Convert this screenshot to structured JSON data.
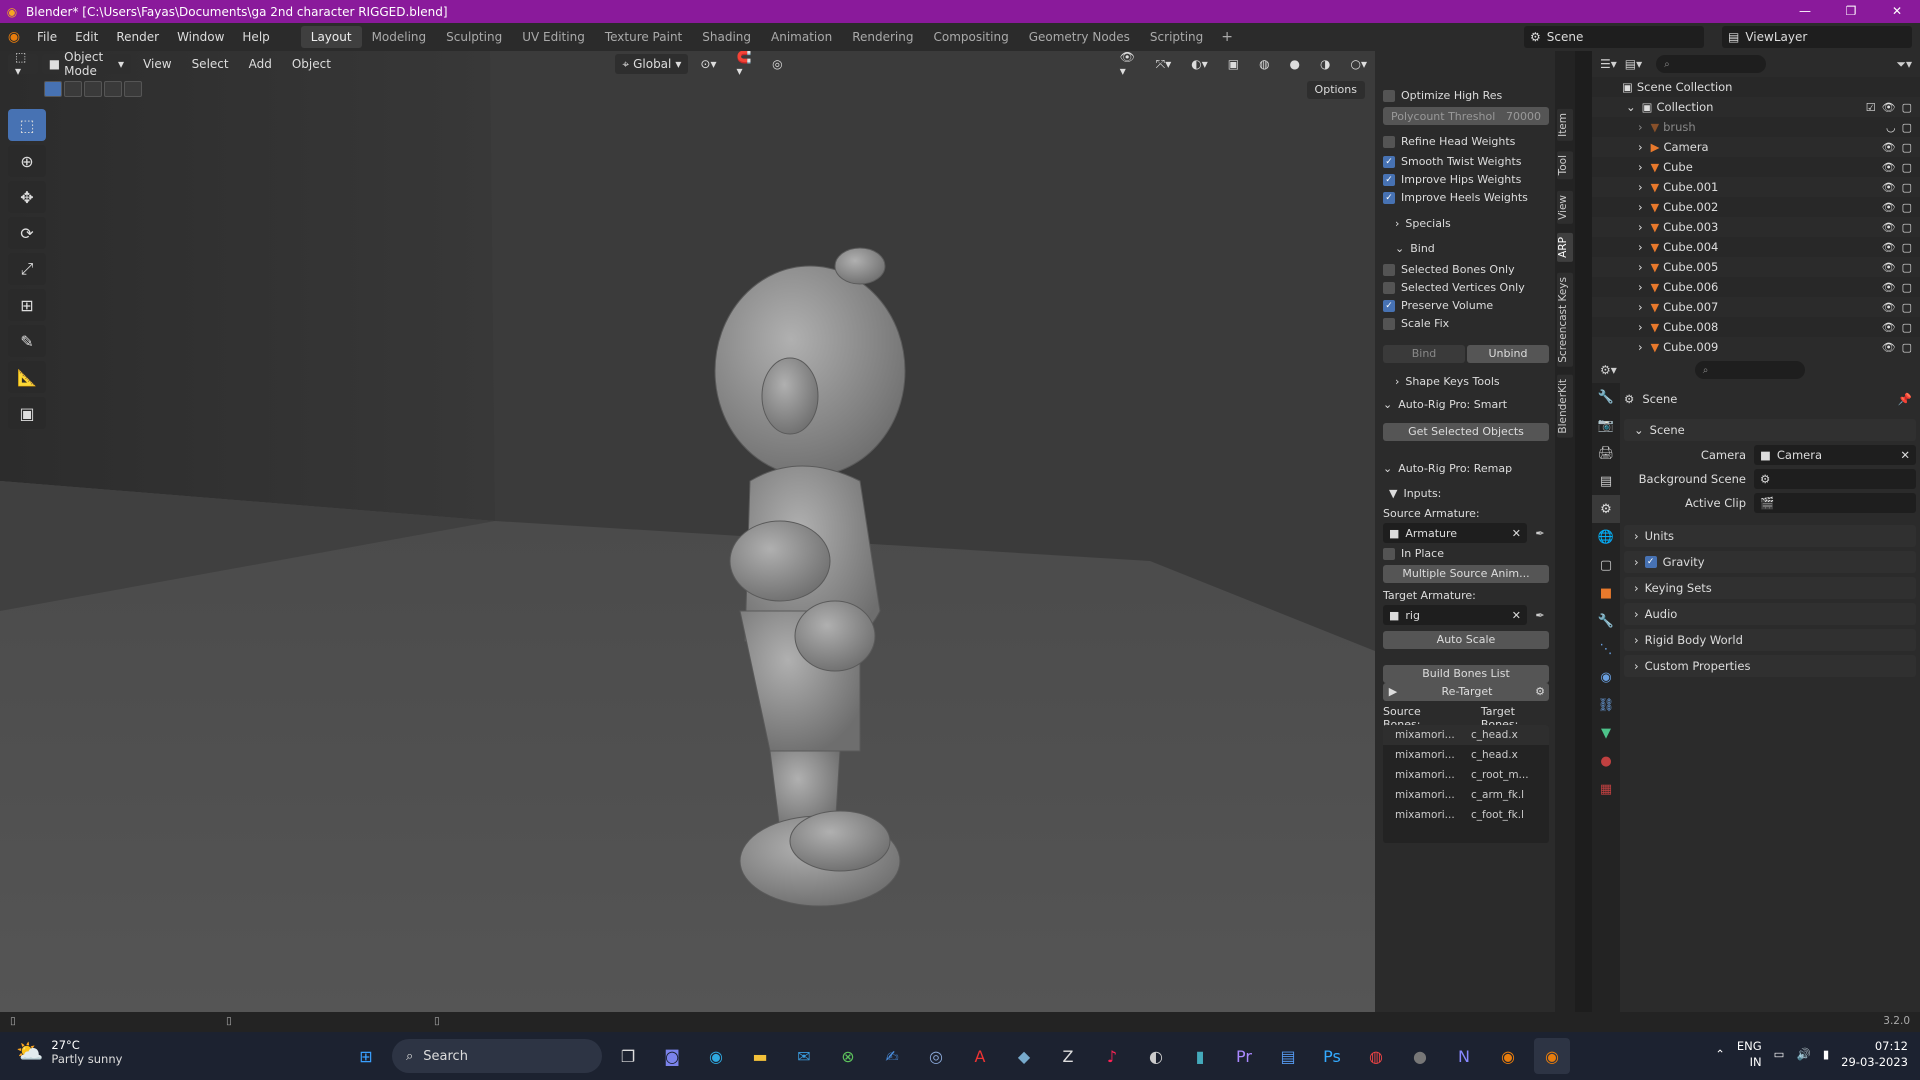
{
  "titlebar": {
    "title": "Blender* [C:\\Users\\Fayas\\Documents\\ga 2nd character RIGGED.blend]"
  },
  "menu": [
    "File",
    "Edit",
    "Render",
    "Window",
    "Help"
  ],
  "workspaces": [
    "Layout",
    "Modeling",
    "Sculpting",
    "UV Editing",
    "Texture Paint",
    "Shading",
    "Animation",
    "Rendering",
    "Compositing",
    "Geometry Nodes",
    "Scripting"
  ],
  "scene_name": "Scene",
  "view_layer": "ViewLayer",
  "viewport": {
    "mode": "Object Mode",
    "menus": [
      "View",
      "Select",
      "Add",
      "Object"
    ],
    "transform": "Global",
    "options": "Options"
  },
  "npanel": {
    "optimize_high_res": "Optimize High Res",
    "polycount_label": "Polycount Threshol",
    "polycount_value": "70000",
    "refine_head": "Refine Head Weights",
    "smooth_twist": "Smooth Twist Weights",
    "improve_hips": "Improve Hips Weights",
    "improve_heels": "Improve Heels Weights",
    "specials": "Specials",
    "bind": "Bind",
    "selected_bones_only": "Selected Bones Only",
    "selected_vertices_only": "Selected Vertices Only",
    "preserve_volume": "Preserve Volume",
    "scale_fix": "Scale Fix",
    "bind_btn": "Bind",
    "unbind_btn": "Unbind",
    "shape_keys_tools": "Shape Keys Tools",
    "smart_header": "Auto-Rig Pro: Smart",
    "get_selected": "Get Selected Objects",
    "remap_header": "Auto-Rig Pro: Remap",
    "inputs": "Inputs:",
    "source_armature_label": "Source Armature:",
    "source_armature": "Armature",
    "in_place": "In Place",
    "multiple_source": "Multiple Source Anim...",
    "target_armature_label": "Target Armature:",
    "target_armature": "rig",
    "auto_scale": "Auto Scale",
    "build_bones": "Build Bones List",
    "retarget": "Re-Target",
    "source_bones": "Source Bones:",
    "target_bones": "Target Bones:",
    "bones": [
      {
        "s": "mixamori...",
        "t": "c_head.x"
      },
      {
        "s": "mixamori...",
        "t": "c_head.x"
      },
      {
        "s": "mixamori...",
        "t": "c_root_m..."
      },
      {
        "s": "mixamori...",
        "t": "c_arm_fk.l"
      },
      {
        "s": "mixamori...",
        "t": "c_foot_fk.l"
      }
    ]
  },
  "vtabs": [
    "Item",
    "Tool",
    "View",
    "ARP",
    "Screencast Keys",
    "BlenderKit"
  ],
  "outliner": {
    "scene_collection": "Scene Collection",
    "collection": "Collection",
    "items": [
      "brush",
      "Camera",
      "Cube",
      "Cube.001",
      "Cube.002",
      "Cube.003",
      "Cube.004",
      "Cube.005",
      "Cube.006",
      "Cube.007",
      "Cube.008",
      "Cube.009"
    ]
  },
  "properties": {
    "header": "Scene",
    "scene_panel": "Scene",
    "camera_label": "Camera",
    "camera_value": "Camera",
    "bg_scene_label": "Background Scene",
    "active_clip_label": "Active Clip",
    "panels": [
      "Units",
      "Gravity",
      "Keying Sets",
      "Audio",
      "Rigid Body World",
      "Custom Properties"
    ]
  },
  "status": {
    "version": "3.2.0"
  },
  "taskbar": {
    "temp": "27°C",
    "weather": "Partly sunny",
    "search": "Search",
    "lang1": "ENG",
    "lang2": "IN",
    "time": "07:12",
    "date": "29-03-2023"
  }
}
